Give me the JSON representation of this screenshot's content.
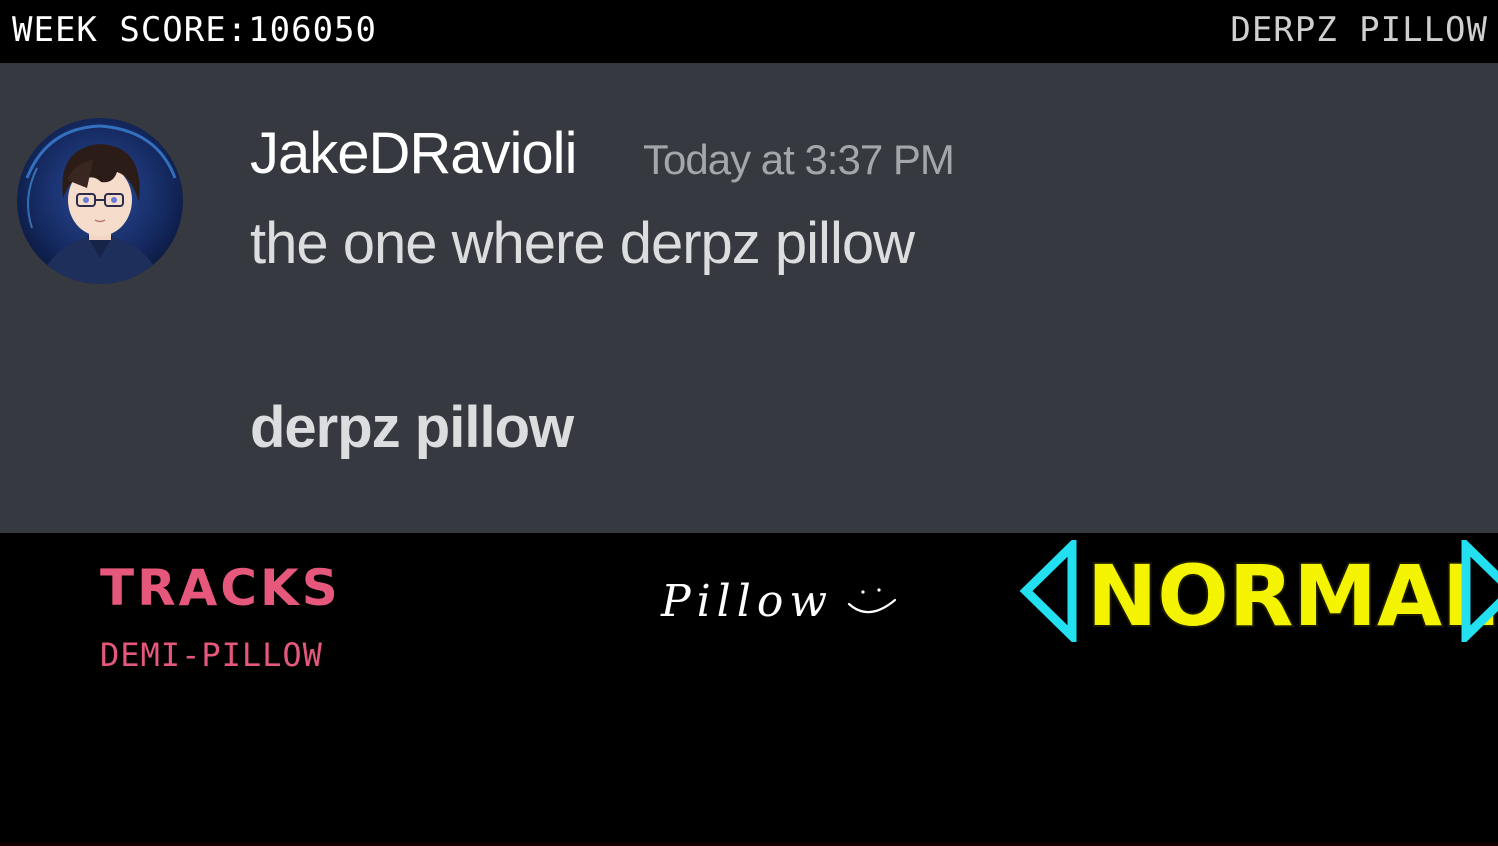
{
  "header": {
    "score_text": "WEEK SCORE:106050",
    "week_name": "DERPZ PILLOW"
  },
  "message": {
    "username": "JakeDRavioli",
    "timestamp": "Today at 3:37 PM",
    "line": "the one where derpz pillow",
    "bold_line": "derpz pillow"
  },
  "tracks": {
    "heading": "TRACKS",
    "items": [
      "DEMI-PILLOW"
    ]
  },
  "week_title": {
    "text": "Pillow"
  },
  "difficulty": {
    "label": "NORMAL"
  },
  "colors": {
    "header_bg": "#000000",
    "stage_bg": "#36393f",
    "tracks_text": "#e5587c",
    "difficulty_fill": "#f4f400",
    "arrow_color": "#22e0f0"
  },
  "icons": {
    "left_arrow": "triangle-left-icon",
    "right_arrow": "triangle-right-icon",
    "avatar": "anime-avatar"
  }
}
